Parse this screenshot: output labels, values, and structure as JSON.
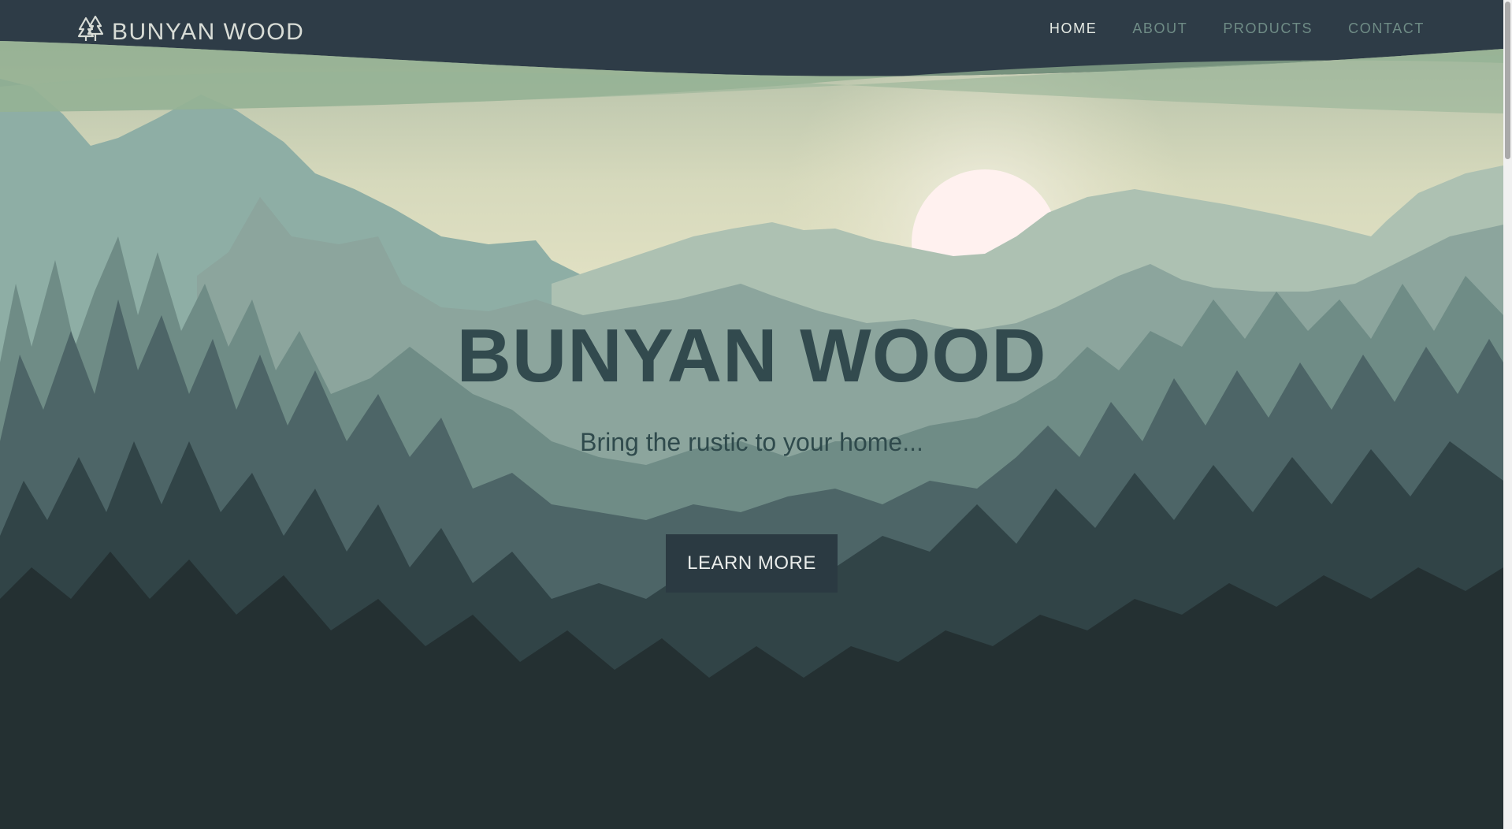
{
  "nav": {
    "brand": "BUNYAN WOOD",
    "brand_icon": "pine-trees-icon",
    "links": [
      {
        "label": "HOME",
        "active": true
      },
      {
        "label": "ABOUT",
        "active": false
      },
      {
        "label": "PRODUCTS",
        "active": false
      },
      {
        "label": "CONTACT",
        "active": false
      }
    ]
  },
  "hero": {
    "title": "BUNYAN WOOD",
    "subtitle": "Bring the rustic to your home...",
    "cta_label": "LEARN MORE"
  },
  "colors": {
    "navbar": "#2e3c47",
    "sky_top": "#b3c0a6",
    "sky_bottom": "#e3e3c4",
    "sun": "#fff1ef",
    "forest_dark": "#243032",
    "title_text": "#324a4e",
    "button_bg": "#2b3a42"
  }
}
